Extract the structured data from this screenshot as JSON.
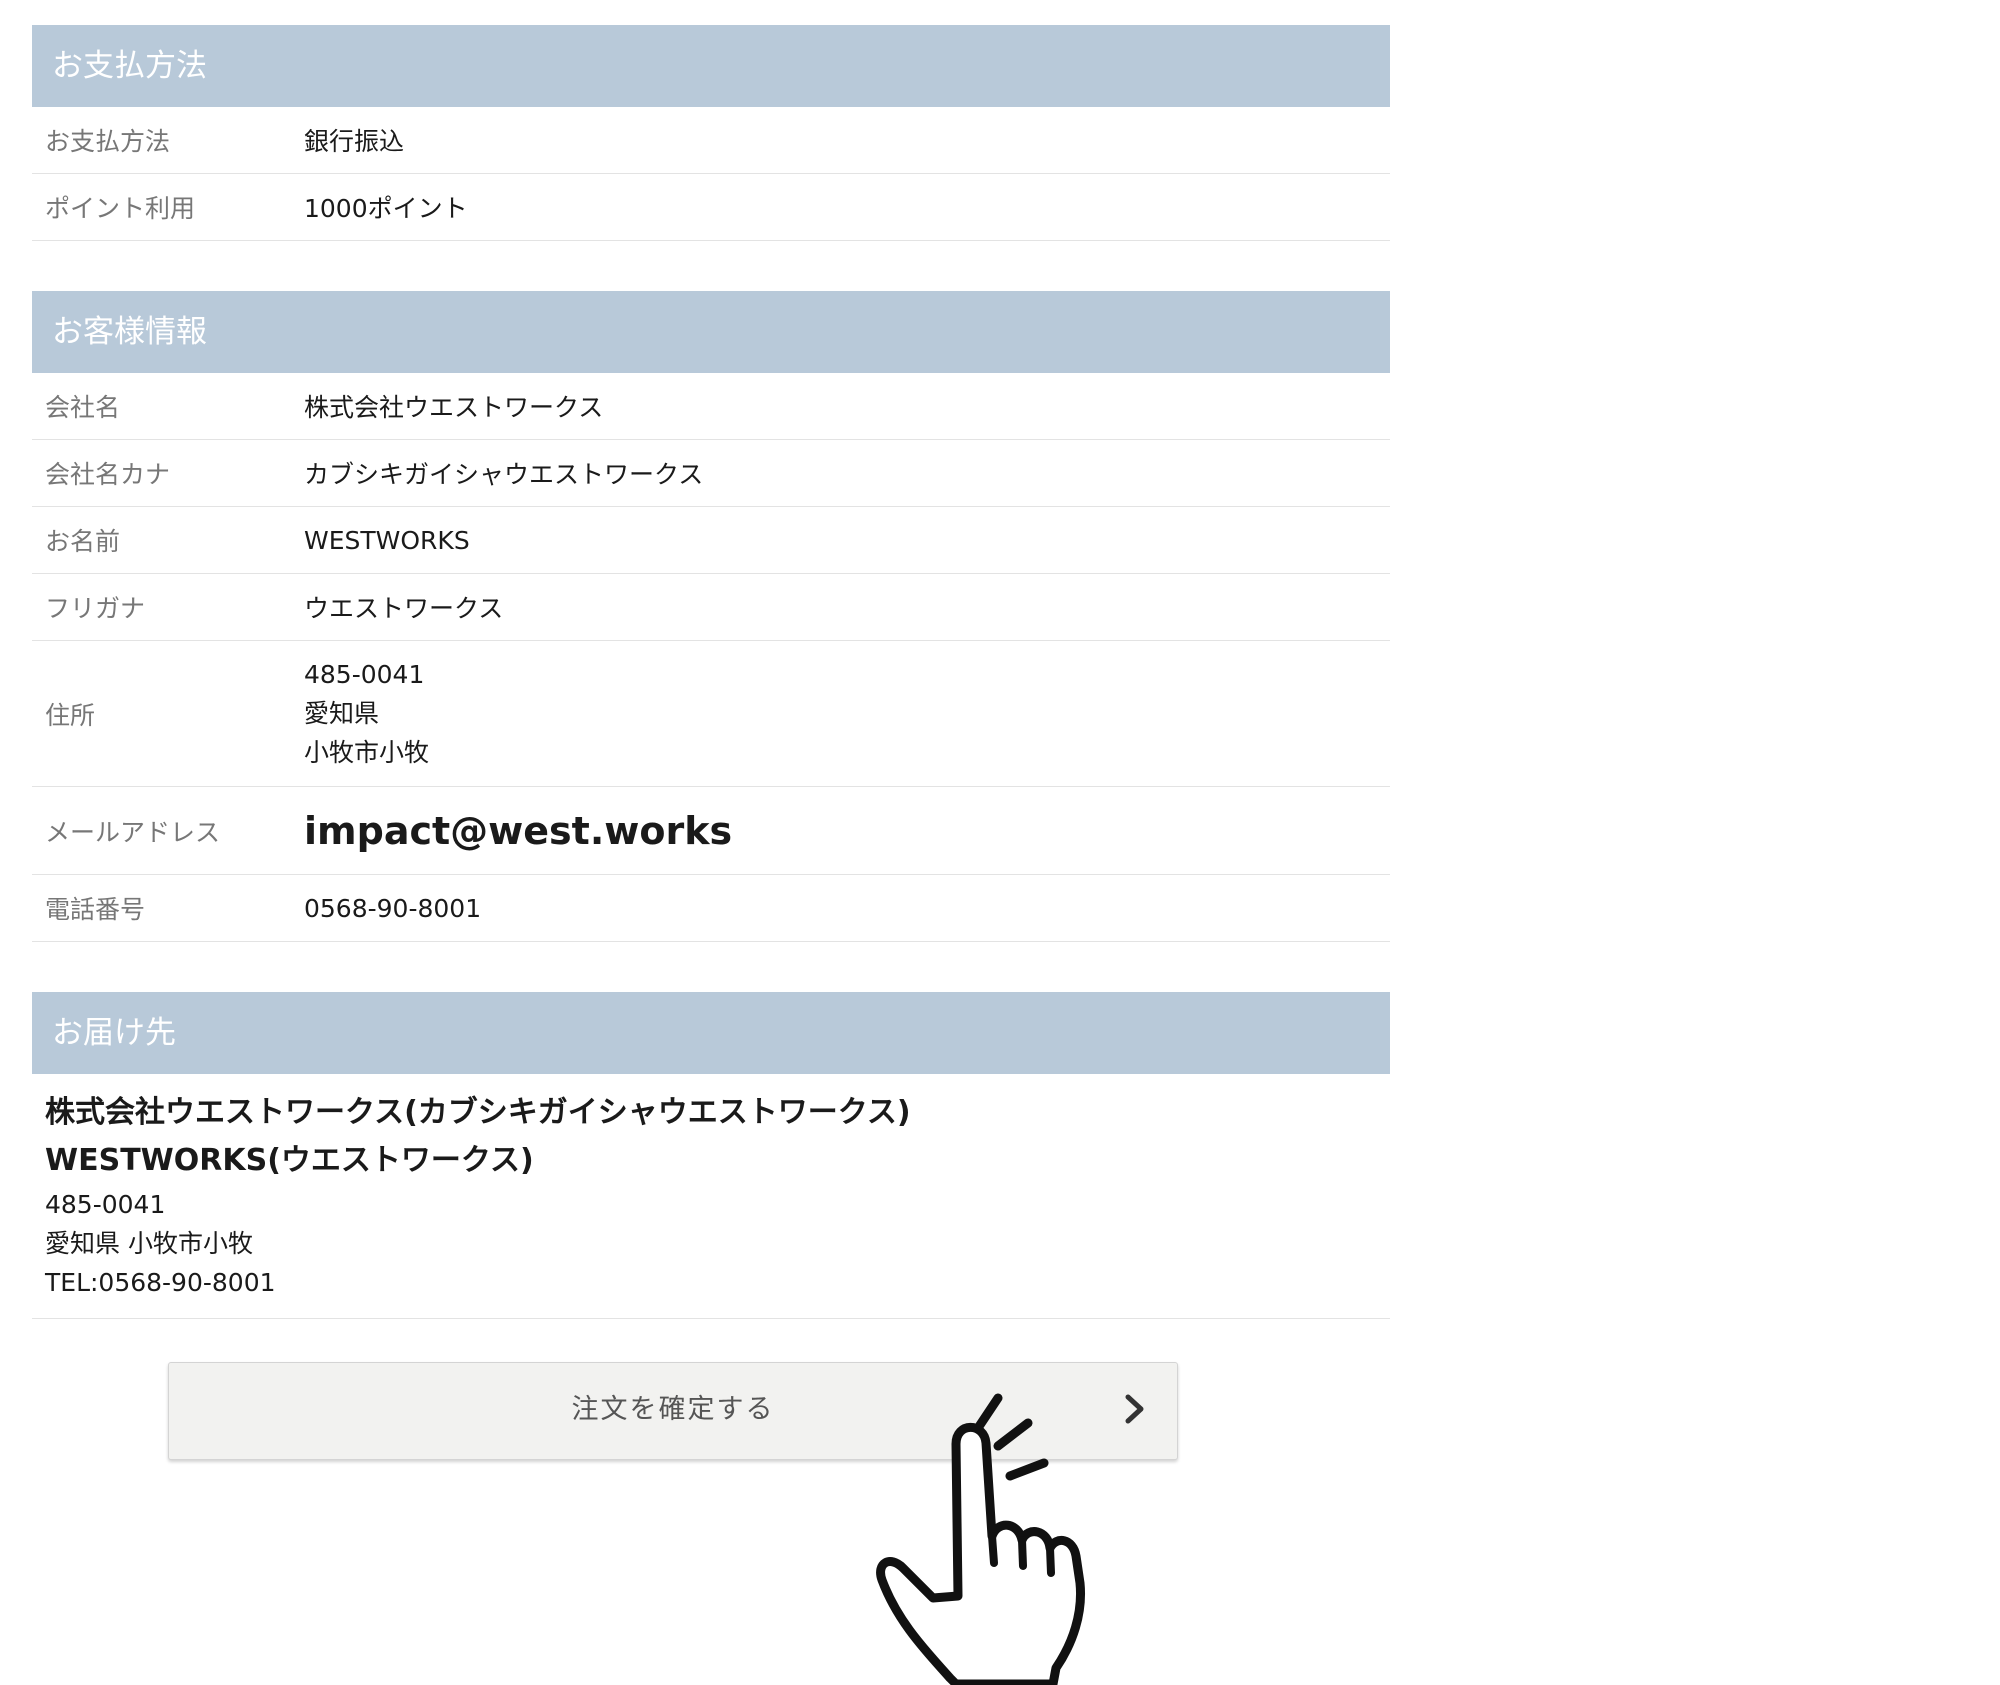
{
  "payment": {
    "header": "お支払方法",
    "rows": [
      {
        "label": "お支払方法",
        "value": "銀行振込"
      },
      {
        "label": "ポイント利用",
        "value": "1000ポイント"
      }
    ]
  },
  "customer": {
    "header": "お客様情報",
    "company_label": "会社名",
    "company_value": "株式会社ウエストワークス",
    "company_kana_label": "会社名カナ",
    "company_kana_value": "カブシキガイシャウエストワークス",
    "name_label": "お名前",
    "name_value": "WESTWORKS",
    "furigana_label": "フリガナ",
    "furigana_value": "ウエストワークス",
    "address_label": "住所",
    "address_lines": [
      "485-0041",
      "愛知県",
      "小牧市小牧"
    ],
    "email_label": "メールアドレス",
    "email_value": "impact@west.works",
    "phone_label": "電話番号",
    "phone_value": "0568-90-8001"
  },
  "delivery": {
    "header": "お届け先",
    "company_line": "株式会社ウエストワークス(カブシキガイシャウエストワークス)",
    "name_line": "WESTWORKS(ウエストワークス)",
    "postal": "485-0041",
    "address": "愛知県 小牧市小牧",
    "tel": "TEL:0568-90-8001"
  },
  "confirm_button": {
    "label": "注文を確定する",
    "icon": "chevron-right-icon"
  },
  "overlay": {
    "icon": "pointing-hand-icon"
  },
  "colors": {
    "section_header_bg": "#b8c9d9",
    "button_bg": "#f2f2f0",
    "label_text": "#777777"
  }
}
